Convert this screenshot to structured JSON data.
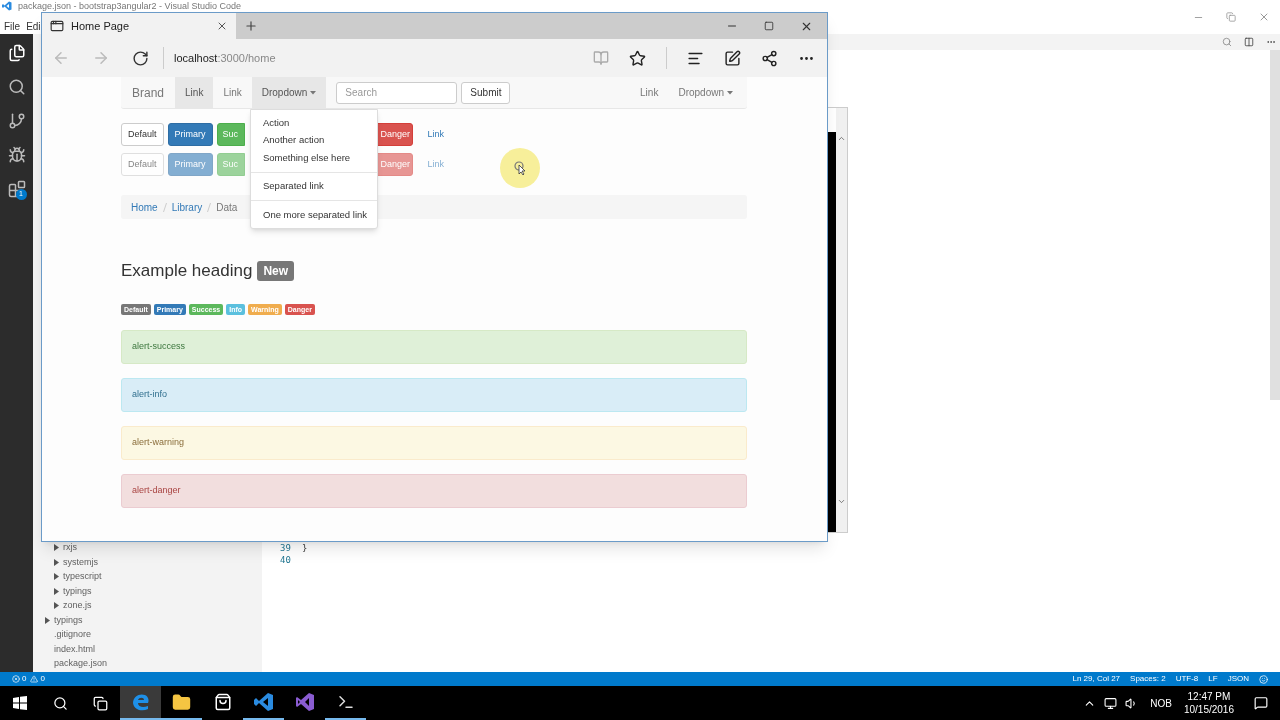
{
  "vscode": {
    "title": "package.json - bootstrap3angular2 - Visual Studio Code",
    "menu": [
      "File",
      "Edi"
    ],
    "activity_badge": "1",
    "explorer": [
      {
        "kind": "group",
        "children": [
          {
            "kind": "folder",
            "label": "rxjs"
          },
          {
            "kind": "folder",
            "label": "systemjs"
          },
          {
            "kind": "folder",
            "label": "typescript"
          },
          {
            "kind": "folder",
            "label": "typings"
          },
          {
            "kind": "folder",
            "label": "zone.js"
          }
        ]
      },
      {
        "kind": "folder",
        "label": "typings"
      },
      {
        "kind": "file",
        "label": ".gitignore"
      },
      {
        "kind": "file",
        "label": "index.html"
      },
      {
        "kind": "file",
        "label": "package.json"
      }
    ],
    "editor": {
      "lines": [
        {
          "number": "39",
          "code": "}"
        },
        {
          "number": "40"
        }
      ]
    },
    "status_bar": {
      "errors": "0",
      "warnings": "0",
      "items": [
        "Ln 29, Col 27",
        "Spaces: 2",
        "UTF-8",
        "LF",
        "JSON"
      ]
    }
  },
  "browser": {
    "tab": {
      "title": "Home Page"
    },
    "address": {
      "host": "localhost",
      "path": ":3000/home"
    },
    "back_disabled": true,
    "forward_disabled": true,
    "page": {
      "navbar": {
        "brand": "Brand",
        "left": [
          {
            "kind": "link",
            "label": "Link",
            "selected": true
          },
          {
            "kind": "link",
            "label": "Link",
            "selected": false
          },
          {
            "kind": "dropdown",
            "label": "Dropdown",
            "selected": true
          }
        ],
        "search": {
          "placeholder": "Search"
        },
        "submit": "Submit",
        "right": [
          {
            "kind": "link",
            "label": "Link",
            "selected": false
          },
          {
            "kind": "dropdown",
            "label": "Dropdown",
            "selected": false
          }
        ]
      },
      "dropdown_menu": [
        {
          "kind": "item",
          "label": "Action"
        },
        {
          "kind": "item",
          "label": "Another action"
        },
        {
          "kind": "item",
          "label": "Something else here"
        },
        {
          "kind": "divider"
        },
        {
          "kind": "item",
          "label": "Separated link"
        },
        {
          "kind": "divider"
        },
        {
          "kind": "item",
          "label": "One more separated link"
        }
      ],
      "button_rows": [
        {
          "disabled": false,
          "buttons": [
            {
              "kind": "default",
              "label": "Default"
            },
            {
              "kind": "primary",
              "label": "Primary"
            },
            {
              "kind": "success",
              "label": "Suc"
            },
            {
              "kind": "danger",
              "label": "Danger"
            },
            {
              "kind": "link",
              "label": "Link"
            }
          ]
        },
        {
          "disabled": true,
          "buttons": [
            {
              "kind": "default",
              "label": "Default"
            },
            {
              "kind": "primary",
              "label": "Primary"
            },
            {
              "kind": "success",
              "label": "Suc"
            },
            {
              "kind": "danger",
              "label": "Danger"
            },
            {
              "kind": "link",
              "label": "Link"
            }
          ]
        }
      ],
      "breadcrumb": [
        {
          "label": "Home",
          "current": false
        },
        {
          "label": "Library",
          "current": false
        },
        {
          "label": "Data",
          "current": true
        }
      ],
      "heading": "Example heading",
      "heading_badge": "New",
      "labels": [
        {
          "kind": "default",
          "label": "Default"
        },
        {
          "kind": "primary",
          "label": "Primary"
        },
        {
          "kind": "success",
          "label": "Success"
        },
        {
          "kind": "info",
          "label": "Info"
        },
        {
          "kind": "warning",
          "label": "Warning"
        },
        {
          "kind": "danger",
          "label": "Danger"
        }
      ],
      "alerts": [
        {
          "kind": "success",
          "text": "alert-success"
        },
        {
          "kind": "info",
          "text": "alert-info"
        },
        {
          "kind": "warning",
          "text": "alert-warning"
        },
        {
          "kind": "danger",
          "text": "alert-danger"
        }
      ]
    }
  },
  "taskbar": {
    "apps": [
      {
        "kind": "edge",
        "running": true,
        "active": true
      },
      {
        "kind": "explorer",
        "running": true,
        "active": false
      },
      {
        "kind": "store",
        "running": false,
        "active": false
      },
      {
        "kind": "vscode",
        "running": true,
        "active": false
      },
      {
        "kind": "visualstudio",
        "running": false,
        "active": false
      },
      {
        "kind": "cmd",
        "running": true,
        "active": false
      }
    ],
    "tray": {
      "language": "NOB",
      "time": "12:47 PM",
      "date": "10/15/2016"
    }
  }
}
